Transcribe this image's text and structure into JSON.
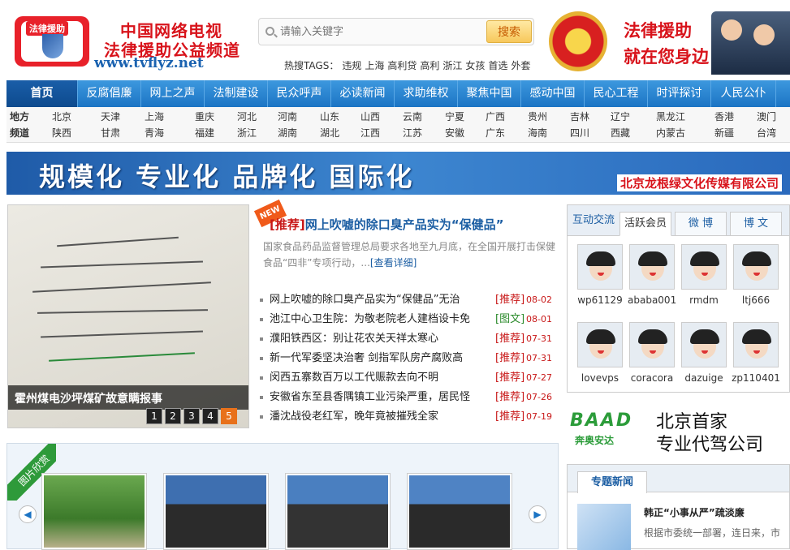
{
  "header": {
    "logo_badge": "法律援助",
    "site_name_line1": "中国网络电视",
    "site_name_line2": "法律援助公益频道",
    "site_url": "www.tvflyz.net",
    "search": {
      "placeholder": "请输入关键字",
      "button": "搜索"
    },
    "hot_label": "热搜TAGS：",
    "hot_tags": [
      "违规",
      "上海",
      "高利贷",
      "高利",
      "浙江",
      "女孩",
      "首选",
      "外套"
    ],
    "slogan_line1": "法律援助",
    "slogan_line2": "就在您身边"
  },
  "nav": [
    "首页",
    "反腐倡廉",
    "网上之声",
    "法制建设",
    "民众呼声",
    "必读新闻",
    "求助维权",
    "聚焦中国",
    "感动中国",
    "民心工程",
    "时评探讨",
    "人民公仆"
  ],
  "regions": {
    "row1_label": "地方",
    "row2_label": "频道",
    "row1": [
      "北京",
      "天津",
      "上海",
      "重庆",
      "河北",
      "河南",
      "山东",
      "山西",
      "云南",
      "宁夏",
      "广西",
      "贵州",
      "吉林",
      "辽宁",
      "黑龙江",
      "香港",
      "澳门"
    ],
    "row2": [
      "陕西",
      "甘肃",
      "青海",
      "福建",
      "浙江",
      "湖南",
      "湖北",
      "江西",
      "江苏",
      "安徽",
      "广东",
      "海南",
      "四川",
      "西藏",
      "内蒙古",
      "新疆",
      "台湾"
    ]
  },
  "banner": {
    "text": "规模化 专业化 品牌化 国际化",
    "company": "北京龙根绿文化传媒有限公司"
  },
  "feature": {
    "caption": "霍州煤电沙坪煤矿故意瞒报事",
    "pages": [
      "1",
      "2",
      "3",
      "4",
      "5"
    ],
    "active_page": 5
  },
  "recommend": {
    "badge": "NEW",
    "tag": "[推荐]",
    "title": "网上吹嘘的除口臭产品实为“保健品”",
    "desc": "国家食品药品监督管理总局要求各地至九月底，在全国开展打击保健食品“四非”专项行动，...",
    "more": "[查看详细]"
  },
  "news": [
    {
      "title": "网上吹嘘的除口臭产品实为“保健品”无治",
      "tag": "[推荐]",
      "date": "08-02"
    },
    {
      "title": "池江中心卫生院：为敬老院老人建档设卡免",
      "tag": "[图文]",
      "date": "08-01"
    },
    {
      "title": "濮阳铁西区：别让花农关天祥太寒心",
      "tag": "[推荐]",
      "date": "07-31"
    },
    {
      "title": "新一代军委坚决治奢 剑指军队房产腐败高",
      "tag": "[推荐]",
      "date": "07-31"
    },
    {
      "title": "闵西五寨数百万以工代赈款去向不明",
      "tag": "[推荐]",
      "date": "07-27"
    },
    {
      "title": "安徽省东至县香隅镇工业污染严重，居民怪",
      "tag": "[推荐]",
      "date": "07-26"
    },
    {
      "title": "潘沈战役老红军，晚年竟被摧残全家",
      "tag": "[推荐]",
      "date": "07-19"
    }
  ],
  "gallery": {
    "label": "图片欣赏",
    "prev": "◀",
    "next": "▶"
  },
  "sidebar": {
    "tabs": [
      "互动交流",
      "活跃会员",
      "微 博",
      "博 文"
    ],
    "members": [
      "wp61129",
      "ababa001",
      "rmdm",
      "ltj666",
      "lovevps",
      "coracora",
      "dazuige",
      "zp110401"
    ]
  },
  "ad": {
    "logo": "BAAD",
    "logo_sub": "奔奥安达",
    "line1": "北京首家",
    "line2": "专业代驾公司"
  },
  "topic": {
    "tab": "专题新闻",
    "title": "韩正“小事从严”疏淡廉",
    "desc": "根据市委统一部署，连日来，市"
  },
  "colors": {
    "nav_blue": "#1c74c4",
    "brand_red": "#d8131b",
    "link_blue": "#1c5ea3",
    "accent_orange": "#e8711b",
    "green": "#2c9c3a"
  }
}
